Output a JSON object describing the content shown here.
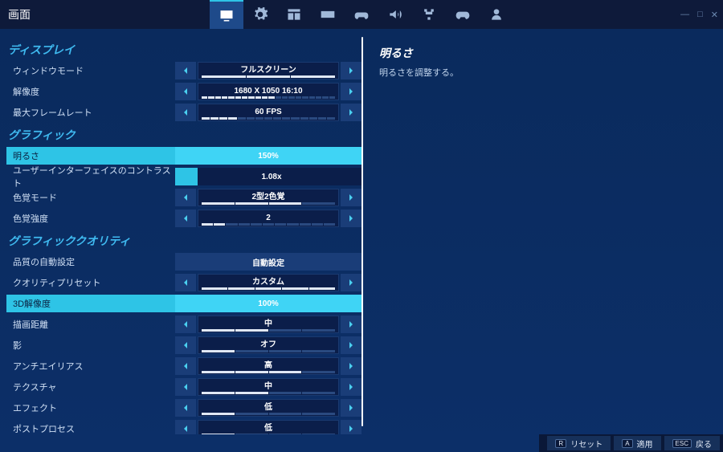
{
  "page_title": "画面",
  "detail": {
    "title": "明るさ",
    "desc": "明るさを調整する。"
  },
  "sections": [
    {
      "header": "ディスプレイ",
      "rows": [
        {
          "type": "stepper",
          "label": "ウィンドウモード",
          "value": "フルスクリーン",
          "ticks": 3,
          "on": 3
        },
        {
          "type": "stepper",
          "label": "解像度",
          "value": "1680 X 1050 16:10",
          "ticks": 20,
          "on": 11
        },
        {
          "type": "stepper",
          "label": "最大フレームレート",
          "value": "60 FPS",
          "ticks": 15,
          "on": 4
        }
      ]
    },
    {
      "header": "グラフィック",
      "rows": [
        {
          "type": "slider",
          "label": "明るさ",
          "value": "150%",
          "fill": 100,
          "highlighted": true
        },
        {
          "type": "slider",
          "label": "ユーザーインターフェイスのコントラスト",
          "value": "1.08x",
          "fill": 12,
          "highlighted": false
        },
        {
          "type": "stepper",
          "label": "色覚モード",
          "value": "2型2色覚",
          "ticks": 4,
          "on": 3
        },
        {
          "type": "stepper",
          "label": "色覚強度",
          "value": "2",
          "ticks": 11,
          "on": 2
        }
      ]
    },
    {
      "header": "グラフィッククオリティ",
      "rows": [
        {
          "type": "button",
          "label": "品質の自動設定",
          "value": "自動設定"
        },
        {
          "type": "stepper",
          "label": "クオリティプリセット",
          "value": "カスタム",
          "ticks": 5,
          "on": 5
        },
        {
          "type": "slider",
          "label": "3D解像度",
          "value": "100%",
          "fill": 100,
          "highlighted": true
        },
        {
          "type": "stepper",
          "label": "描画距離",
          "value": "中",
          "ticks": 4,
          "on": 2
        },
        {
          "type": "stepper",
          "label": "影",
          "value": "オフ",
          "ticks": 4,
          "on": 1
        },
        {
          "type": "stepper",
          "label": "アンチエイリアス",
          "value": "高",
          "ticks": 4,
          "on": 3
        },
        {
          "type": "stepper",
          "label": "テクスチャ",
          "value": "中",
          "ticks": 4,
          "on": 2
        },
        {
          "type": "stepper",
          "label": "エフェクト",
          "value": "低",
          "ticks": 4,
          "on": 1
        },
        {
          "type": "stepper",
          "label": "ポストプロセス",
          "value": "低",
          "ticks": 4,
          "on": 1
        }
      ]
    }
  ],
  "footer": {
    "reset": {
      "key": "R",
      "label": "リセット"
    },
    "apply": {
      "key": "A",
      "label": "適用"
    },
    "back": {
      "key": "ESC",
      "label": "戻る"
    }
  }
}
